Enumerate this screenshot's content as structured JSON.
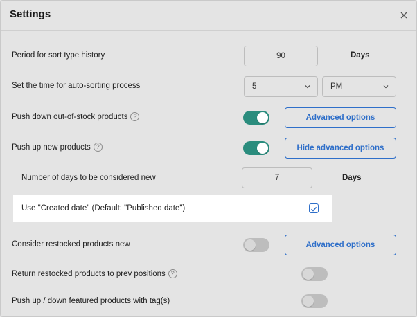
{
  "dialog": {
    "title": "Settings",
    "close_icon": "close-icon"
  },
  "sort_history": {
    "label": "Period for sort type history",
    "value": "90",
    "unit": "Days"
  },
  "auto_sort_time": {
    "label": "Set the time for auto-sorting process",
    "hour": "5",
    "period": "PM"
  },
  "push_down_oos": {
    "label": "Push down out-of-stock products",
    "enabled": true,
    "button": "Advanced options"
  },
  "push_up_new": {
    "label": "Push up new products",
    "enabled": true,
    "button": "Hide advanced options"
  },
  "new_days": {
    "label": "Number of days to be considered new",
    "value": "7",
    "unit": "Days"
  },
  "created_date": {
    "label": "Use \"Created date\" (Default: \"Published date\")",
    "checked": true
  },
  "restocked_new": {
    "label": "Consider restocked products new",
    "enabled": false,
    "button": "Advanced options"
  },
  "return_restocked": {
    "label": "Return restocked products to prev positions",
    "enabled": false
  },
  "featured_tags": {
    "label": "Push up / down featured products with tag(s)",
    "enabled": false
  },
  "help_glyph": "?",
  "colors": {
    "accent": "#2f6fc9",
    "toggle_on": "#2a8c7d",
    "toggle_off": "#bdbdbd"
  }
}
